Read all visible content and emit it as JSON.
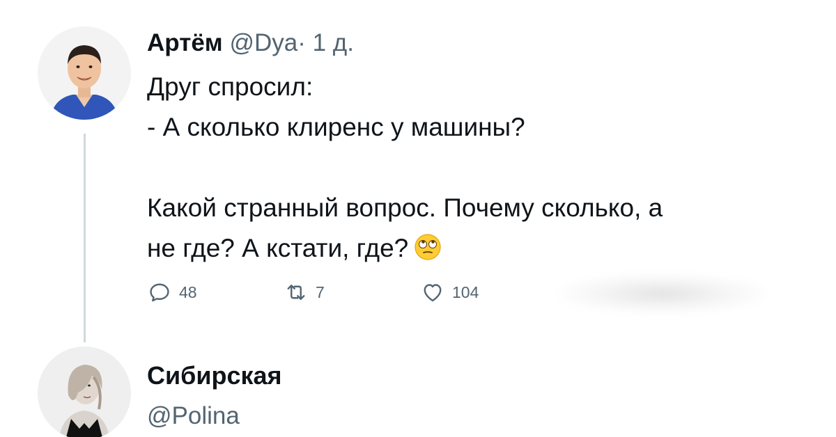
{
  "tweet": {
    "author_name": "Артём",
    "author_handle": "@Dya",
    "separator": "·",
    "time": "1 д.",
    "lines": [
      "Друг спросил:",
      "- А сколько клиренс у машины?",
      "",
      "Какой странный вопрос. Почему сколько, а",
      "не где? А кстати, где?"
    ],
    "emoji": "face-with-rolling-eyes",
    "actions": {
      "reply_count": "48",
      "retweet_count": "7",
      "like_count": "104"
    }
  },
  "reply": {
    "author_name": "Сибирская",
    "author_handle": "@Polina"
  },
  "colors": {
    "text_primary": "#0f1419",
    "text_secondary": "#536471",
    "thread_line": "#cfd9de",
    "shirt": "#1d4ed8"
  }
}
